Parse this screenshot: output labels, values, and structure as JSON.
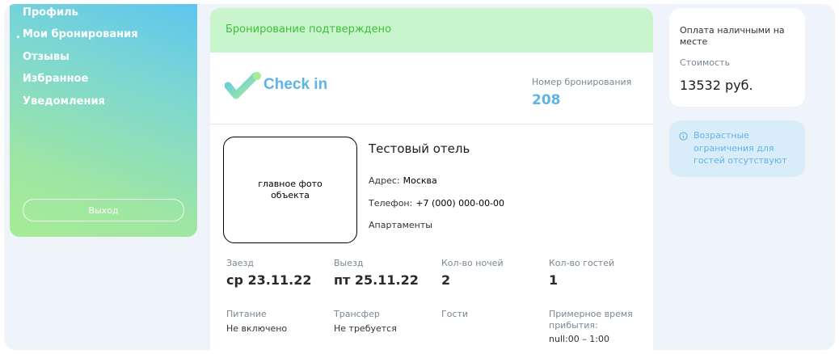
{
  "sidebar": {
    "items": [
      {
        "label": "Профиль"
      },
      {
        "label": "Мои бронирования",
        "active": true
      },
      {
        "label": "Отзывы"
      },
      {
        "label": "Избранное"
      },
      {
        "label": "Уведомления"
      }
    ],
    "logout_label": "Выход"
  },
  "booking": {
    "status": "Бронирование подтверждено",
    "logo_text": "Check in",
    "number_label": "Номер бронирования",
    "number": "208",
    "photo_placeholder": "главное фото объекта",
    "hotel_name": "Тестовый отель",
    "address_label": "Адрес:",
    "address": "Москва",
    "phone_label": "Телефон:",
    "phone": "+7 (000) 000-00-00",
    "room_type": "Апартаменты",
    "checkin_label": "Заезд",
    "checkin": "ср 23.11.22",
    "checkout_label": "Выезд",
    "checkout": "пт 25.11.22",
    "nights_label": "Кол-во ночей",
    "nights": "2",
    "guests_label": "Кол-во гостей",
    "guests": "1",
    "meal_label": "Питание",
    "meal": "Не включено",
    "transfer_label": "Трансфер",
    "transfer": "Не требуется",
    "guests_list_label": "Гости",
    "arrival_label": "Примерное время прибытия:",
    "arrival": "null:00 – 1:00"
  },
  "payment": {
    "title": "Оплата наличными на месте",
    "cost_label": "Стоимость",
    "cost": "13532 руб."
  },
  "notice": {
    "icon": "info-icon",
    "text": "Возрастные ограничения для гостей отсутствуют"
  },
  "colors": {
    "accent": "#5cb5e6",
    "success": "#3fbf3a",
    "banner": "#c8f5cb"
  }
}
